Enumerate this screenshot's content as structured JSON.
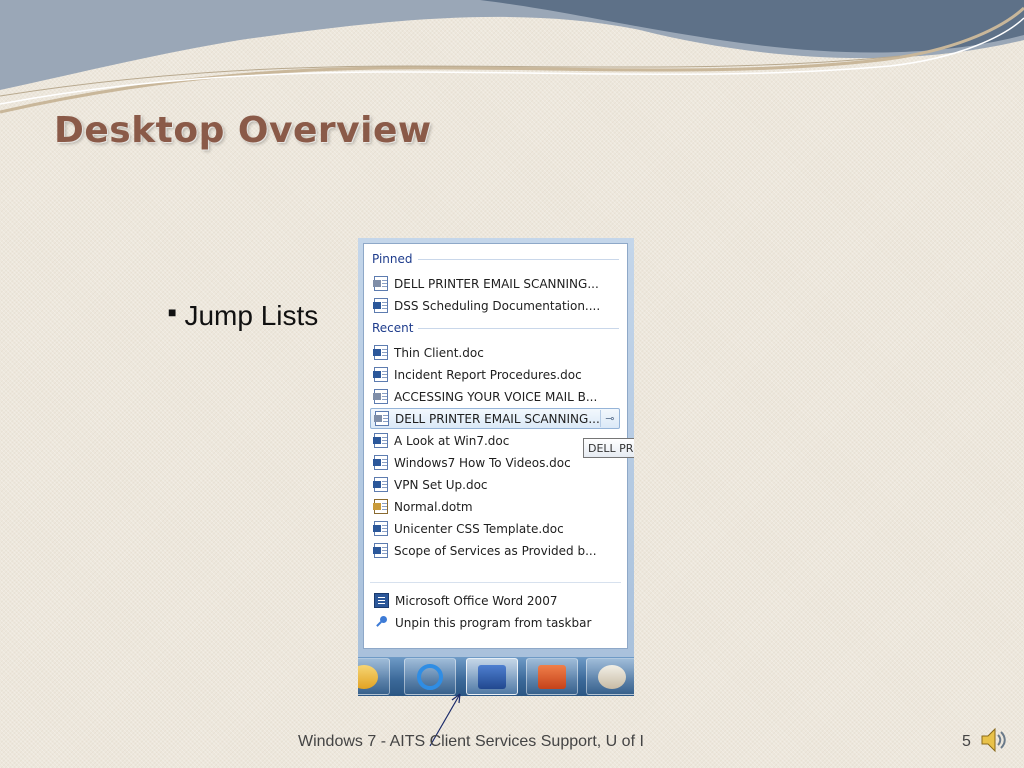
{
  "slide": {
    "title": "Desktop Overview",
    "bullet": "Jump Lists",
    "footer": "Windows 7 - AITS Client Services Support, U of I",
    "page_number": "5"
  },
  "jump_list": {
    "pinned_header": "Pinned",
    "pinned": [
      {
        "label": "DELL PRINTER EMAIL SCANNING...",
        "icon": "word-doc-icon"
      },
      {
        "label": "DSS Scheduling Documentation....",
        "icon": "word-doc-icon"
      }
    ],
    "recent_header": "Recent",
    "recent": [
      {
        "label": "Thin Client.doc",
        "icon": "word-doc-icon"
      },
      {
        "label": "Incident Report Procedures.doc",
        "icon": "word-doc-icon"
      },
      {
        "label": "ACCESSING YOUR VOICE MAIL B...",
        "icon": "word-doc-icon"
      },
      {
        "label": "DELL PRINTER EMAIL SCANNING...",
        "icon": "word-doc-icon",
        "highlighted": true
      },
      {
        "label": "A Look at Win7.doc",
        "icon": "word-doc-icon"
      },
      {
        "label": "Windows7 How To Videos.doc",
        "icon": "word-doc-icon"
      },
      {
        "label": "VPN Set Up.doc",
        "icon": "word-doc-icon"
      },
      {
        "label": "Normal.dotm",
        "icon": "word-template-icon"
      },
      {
        "label": "Unicenter CSS Template.doc",
        "icon": "word-doc-icon"
      },
      {
        "label": "Scope of Services as  Provided b...",
        "icon": "word-doc-icon"
      }
    ],
    "tooltip": "DELL PR",
    "tasks": [
      {
        "label": "Microsoft Office Word 2007",
        "icon": "word-app-icon"
      },
      {
        "label": "Unpin this program from taskbar",
        "icon": "unpin-icon"
      }
    ]
  },
  "taskbar": {
    "buttons": [
      {
        "icon": "outlook-icon"
      },
      {
        "icon": "internet-explorer-icon"
      },
      {
        "icon": "word-icon",
        "active": true
      },
      {
        "icon": "powerpoint-icon"
      },
      {
        "icon": "paint-icon"
      }
    ]
  },
  "colors": {
    "title": "#8a5a48",
    "background": "#ede7dc",
    "section_header": "#1e3c8c",
    "taskbar": "#3a6898"
  }
}
